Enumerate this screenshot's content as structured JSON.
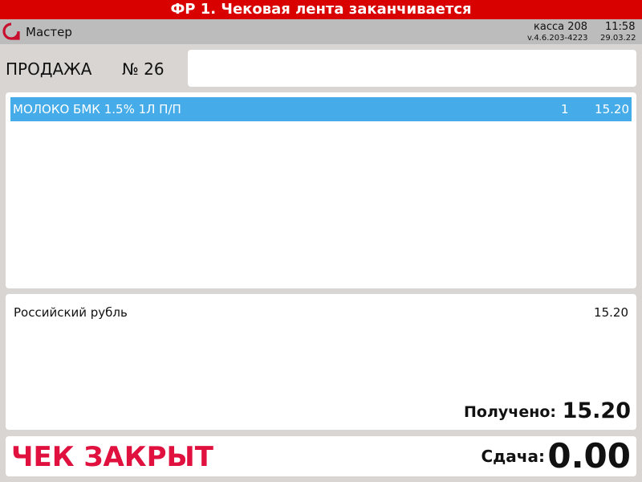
{
  "alert": {
    "text": "ФР 1. Чековая лента заканчивается"
  },
  "status_bar": {
    "logo_icon": "brand-logo-icon",
    "user": "Мастер",
    "kassa": "касса 208",
    "time": "11:58",
    "version": "v.4.6.203-4223",
    "date": "29.03.22"
  },
  "sale": {
    "label": "ПРОДАЖА",
    "number": "№ 26",
    "input_value": ""
  },
  "items": [
    {
      "name": "МОЛОКО БМК 1.5% 1Л П/П",
      "qty": "1",
      "sum": "15.20",
      "selected": true
    }
  ],
  "payment": {
    "currency": "Российский рубль",
    "amount": "15.20",
    "received_label": "Получено:",
    "received_value": "15.20"
  },
  "footer": {
    "status": "ЧЕК ЗАКРЫТ",
    "change_label": "Сдача:",
    "change_value": "0.00"
  },
  "colors": {
    "alert_bg": "#d90000",
    "selected_row": "#45ace9",
    "status_red": "#e0103f",
    "logo_red": "#c8102e"
  }
}
